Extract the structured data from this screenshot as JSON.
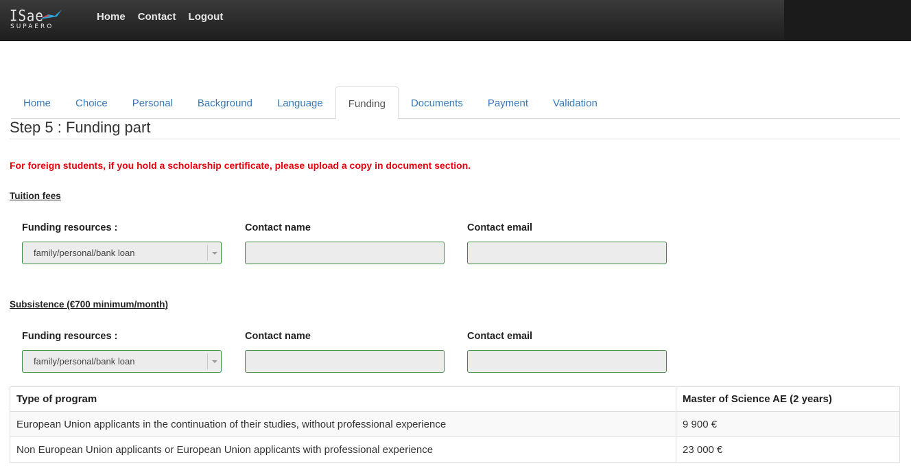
{
  "topbar": {
    "logo": {
      "main": "ISae",
      "sub": "SUPAERO"
    },
    "nav": [
      "Home",
      "Contact",
      "Logout"
    ]
  },
  "tabs": [
    {
      "label": "Home",
      "active": false
    },
    {
      "label": "Choice",
      "active": false
    },
    {
      "label": "Personal",
      "active": false
    },
    {
      "label": "Background",
      "active": false
    },
    {
      "label": "Language",
      "active": false
    },
    {
      "label": "Funding",
      "active": true
    },
    {
      "label": "Documents",
      "active": false
    },
    {
      "label": "Payment",
      "active": false
    },
    {
      "label": "Validation",
      "active": false
    }
  ],
  "page_title": "Step 5 : Funding part",
  "warning": "For foreign students, if you hold a scholarship certificate, please upload a copy in document section.",
  "tuition": {
    "heading": "Tuition fees",
    "funding_label": "Funding resources :",
    "funding_value": "family/personal/bank loan",
    "contact_name_label": "Contact name",
    "contact_name_value": "",
    "contact_email_label": "Contact email",
    "contact_email_value": ""
  },
  "subsistence": {
    "heading": "Subsistence (€700 minimum/month)",
    "funding_label": "Funding resources :",
    "funding_value": "family/personal/bank loan",
    "contact_name_label": "Contact name",
    "contact_name_value": "",
    "contact_email_label": "Contact email",
    "contact_email_value": ""
  },
  "program_table": {
    "headers": [
      "Type of program",
      "Master of Science AE (2 years)"
    ],
    "rows": [
      [
        "European Union applicants in the continuation of their studies, without professional experience",
        "9 900 €"
      ],
      [
        "Non European Union applicants or European Union applicants with professional experience",
        "23 000 €"
      ]
    ]
  },
  "colors": {
    "accent_link": "#3a79b8",
    "warning": "#e8000b",
    "field_border": "#3a8a3e",
    "topbar": "#2a2a2a"
  },
  "icons": [
    "isae-bird-logo-icon",
    "chevron-down-icon"
  ]
}
